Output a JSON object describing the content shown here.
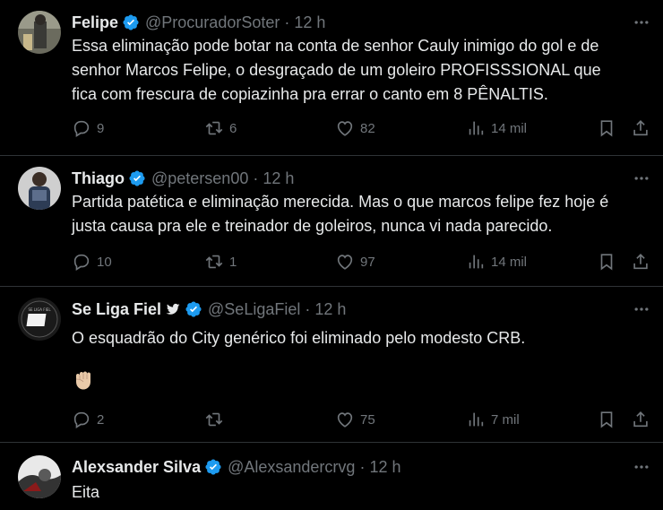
{
  "tweets": [
    {
      "name": "Felipe",
      "handle": "@ProcuradorSoter",
      "time": "12 h",
      "lines": [
        "Essa eliminação pode botar na conta de senhor Cauly inimigo do gol e de",
        "senhor Marcos Felipe, o desgraçado de um goleiro PROFISSSIONAL que",
        "fica com frescura de copiazinha pra errar o canto em 8 PÊNALTIS."
      ],
      "replies": "9",
      "retweets": "6",
      "likes": "82",
      "views": "14 mil"
    },
    {
      "name": "Thiago",
      "handle": "@petersen00",
      "time": "12 h",
      "lines": [
        "Partida patética e eliminação merecida. Mas o que marcos felipe fez hoje é",
        "justa causa pra ele e treinador de goleiros, nunca vi nada parecido."
      ],
      "replies": "10",
      "retweets": "1",
      "likes": "97",
      "views": "14 mil"
    },
    {
      "name": "Se Liga Fiel",
      "handle": "@SeLigaFiel",
      "time": "12 h",
      "lines": [
        "O esquadrão do City genérico foi eliminado pelo modesto CRB."
      ],
      "avatar_text": "SE LIGA FIEL",
      "emoji": "raised-fist",
      "replies": "2",
      "retweets": "",
      "likes": "75",
      "views": "7 mil"
    },
    {
      "name": "Alexsander Silva",
      "handle": "@Alexsandercrvg",
      "time": "12 h",
      "lines": [
        "Eita"
      ]
    }
  ],
  "colors": {
    "background": "#000000",
    "text": "#e7e9ea",
    "muted": "#71767b",
    "verified": "#1d9bf0",
    "divider": "#2f3336"
  },
  "icons": [
    "verified-badge-icon",
    "twitter-bird-icon",
    "more-icon",
    "reply-icon",
    "retweet-icon",
    "like-icon",
    "views-icon",
    "bookmark-icon",
    "share-icon"
  ]
}
